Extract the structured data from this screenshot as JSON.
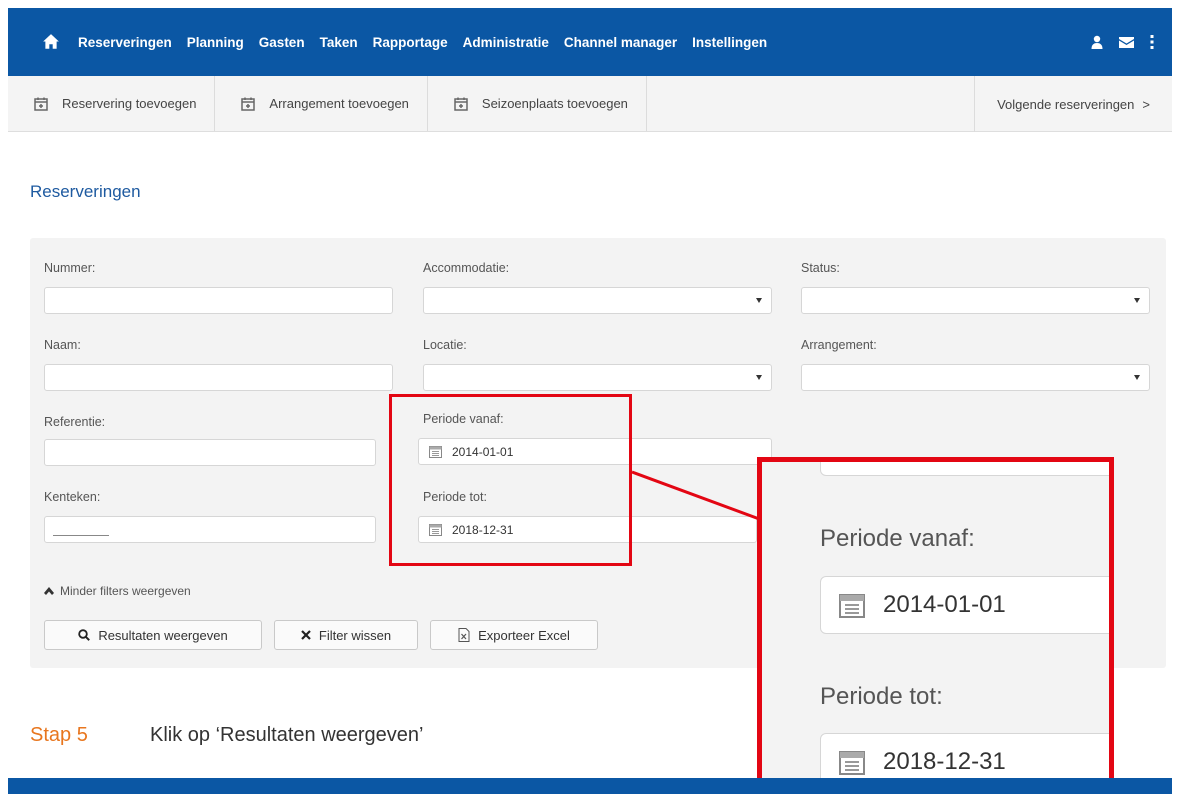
{
  "nav": {
    "items": [
      "Reserveringen",
      "Planning",
      "Gasten",
      "Taken",
      "Rapportage",
      "Administratie",
      "Channel manager",
      "Instellingen"
    ],
    "icons": [
      "home-icon",
      "user-icon",
      "envelope-icon",
      "more-vertical-icon"
    ],
    "color": "#0b57a4"
  },
  "subnav": {
    "items": [
      "Reservering toevoegen",
      "Arrangement toevoegen",
      "Seizoenplaats toevoegen"
    ],
    "next": "Volgende reserveringen",
    "next_chevron": ">"
  },
  "page": {
    "title": "Reserveringen"
  },
  "filters": {
    "nummer": {
      "label": "Nummer:",
      "value": ""
    },
    "accommodatie": {
      "label": "Accommodatie:",
      "value": ""
    },
    "status": {
      "label": "Status:",
      "value": ""
    },
    "naam": {
      "label": "Naam:",
      "value": ""
    },
    "locatie": {
      "label": "Locatie:",
      "value": ""
    },
    "arrangement": {
      "label": "Arrangement:",
      "value": ""
    },
    "referentie": {
      "label": "Referentie:",
      "value": ""
    },
    "periode_vanaf": {
      "label": "Periode vanaf:",
      "value": "2014-01-01"
    },
    "kenteken": {
      "label": "Kenteken:",
      "value": ""
    },
    "periode_tot": {
      "label": "Periode tot:",
      "value": "2018-12-31"
    }
  },
  "toggle": "Minder filters weergeven",
  "buttons": {
    "results": "Resultaten weergeven",
    "clear": "Filter wissen",
    "export": "Exporteer Excel"
  },
  "step": {
    "number": "Stap 5",
    "text": "Klik op ‘Resultaten weergeven’",
    "color": "#e8761e"
  },
  "highlight_color": "#e30613"
}
